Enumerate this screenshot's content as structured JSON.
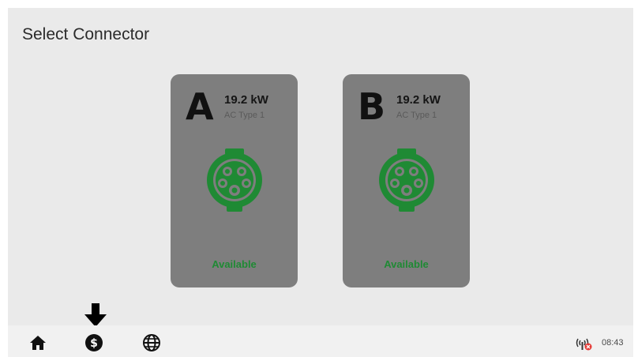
{
  "header": {
    "title": "Select Connector"
  },
  "connectors": [
    {
      "letter": "A",
      "power": "19.2 kW",
      "type": "AC Type 1",
      "status": "Available",
      "status_color": "#1f8a34"
    },
    {
      "letter": "B",
      "power": "19.2 kW",
      "type": "AC Type 1",
      "status": "Available",
      "status_color": "#1f8a34"
    }
  ],
  "taskbar": {
    "icons": [
      "home-icon",
      "dollar-icon",
      "globe-icon"
    ],
    "signal_icon": "signal-off-icon",
    "time": "08:43"
  },
  "colors": {
    "card_bg": "#7e7e7e",
    "accent_green": "#1f8a34",
    "screen_bg": "#eaeaea"
  }
}
